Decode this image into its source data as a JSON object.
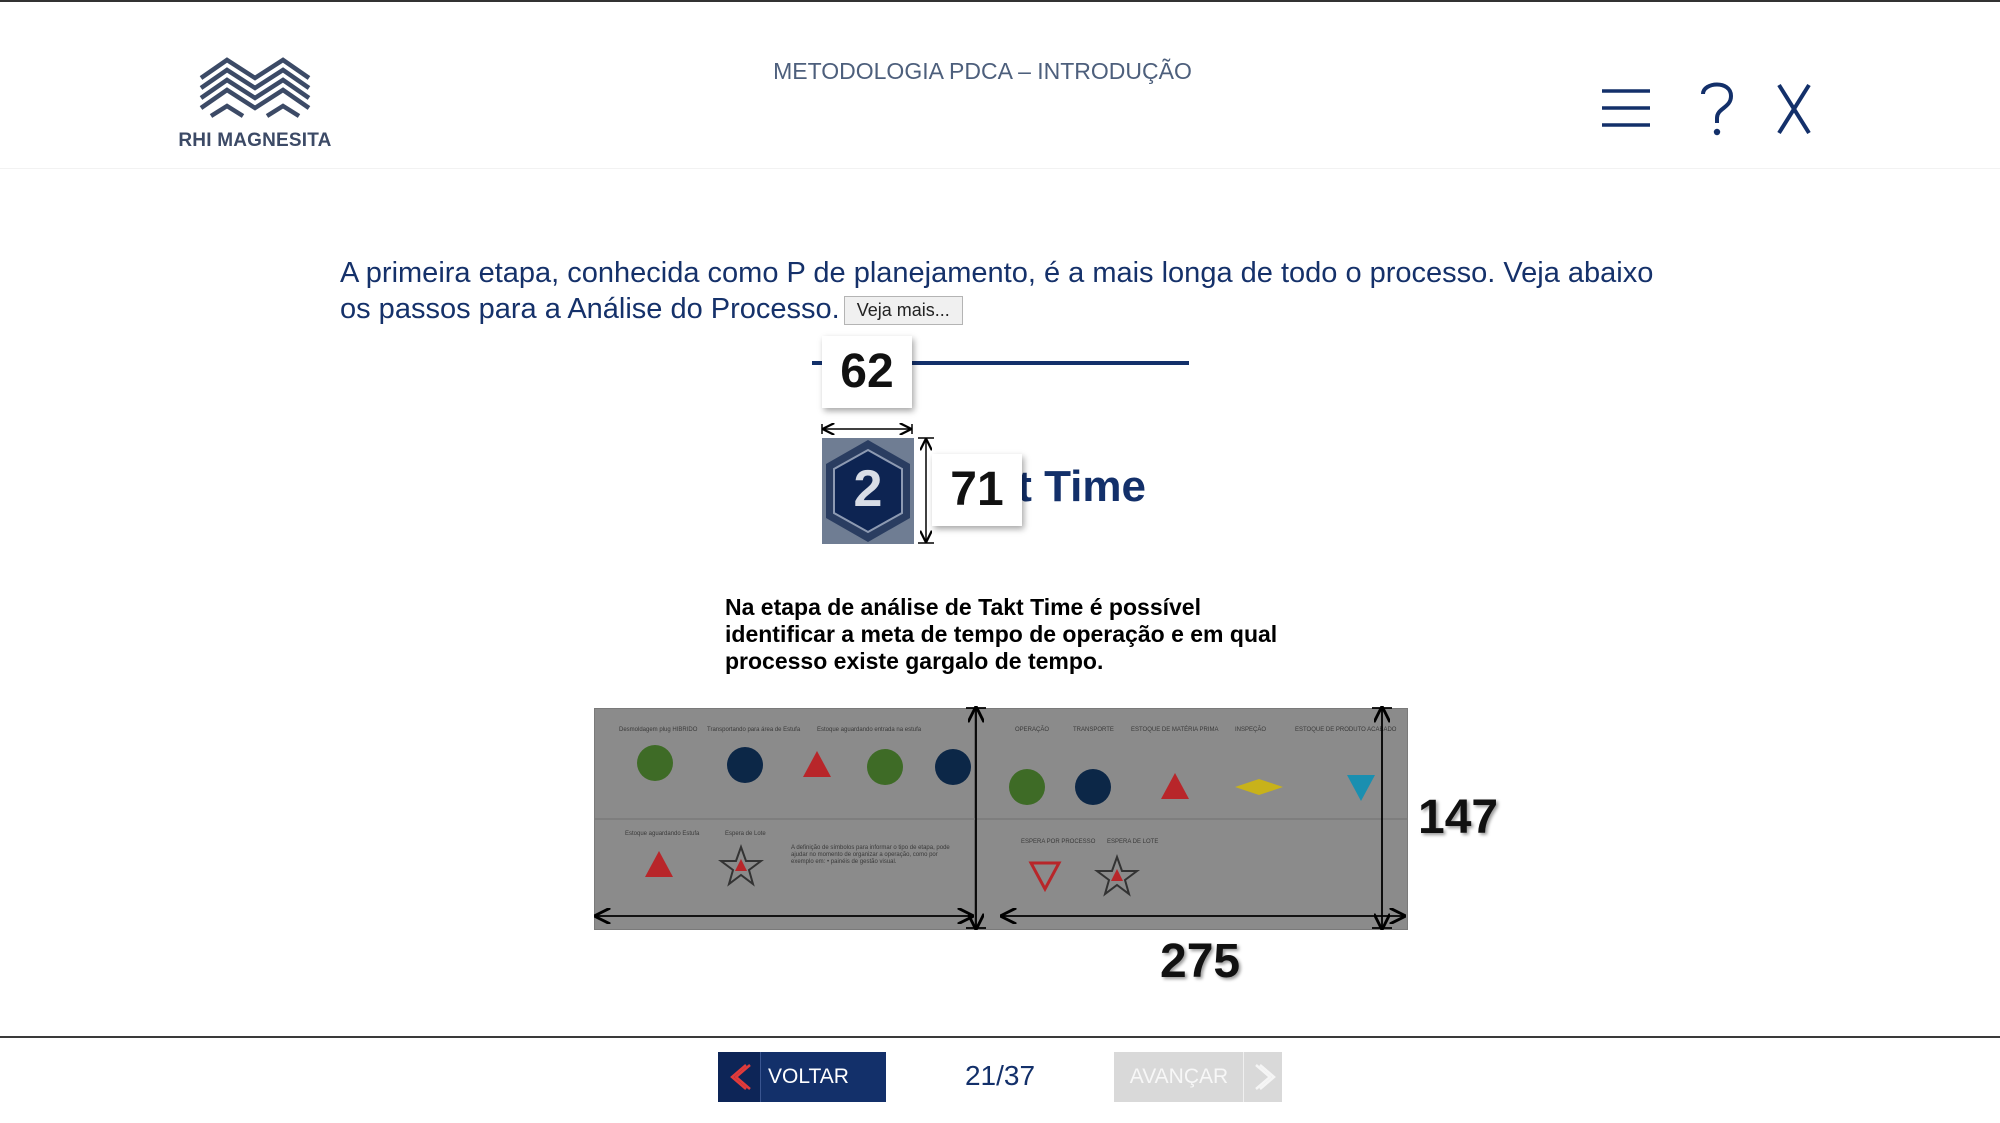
{
  "header": {
    "brand": "RHI MAGNESITA",
    "course_title": "METODOLOGIA PDCA – INTRODUÇÃO",
    "menu_icon": "menu-icon",
    "help_label": "?",
    "close_label": "X"
  },
  "content": {
    "intro_text": "A primeira etapa, conhecida como P de planejamento, é a mais longa de todo o processo. Veja abaixo os passos para a Análise do Processo.",
    "more_button": "Veja mais...",
    "step": {
      "number": "2",
      "title": "Takt Time",
      "visible_title": "ıt Time"
    },
    "description": "Na etapa de análise de Takt Time é possível identificar a meta de tempo de operação e em qual processo existe gargalo de tempo.",
    "annotations": {
      "hex_width": "62",
      "hex_height": "71",
      "figure_height": "147",
      "figure_width": "275"
    },
    "figure_labels": {
      "left_headers": [
        "Desmoldagem plug HIBRIDO",
        "Transportando para área de Estufa",
        "Estoque aguardando entrada na estufa"
      ],
      "left_lower_headers": [
        "Estoque aguardando Estufa",
        "Espera de Lote"
      ],
      "left_lower_text": "A definição de símbolos para informar o tipo de etapa, pode ajudar no momento de organizar a operação, como por exemplo em: • painéis de gestão visual.",
      "right_headers": [
        "OPERAÇÃO",
        "TRANSPORTE",
        "ESTOQUE DE MATÉRIA PRIMA",
        "INSPEÇÃO",
        "ESTOQUE DE PRODUTO ACABADO"
      ],
      "right_lower_headers": [
        "ESPERA POR PROCESSO",
        "ESPERA DE LOTE"
      ]
    }
  },
  "footer": {
    "back_label": "VOLTAR",
    "next_label": "AVANÇAR",
    "page_indicator": "21/37"
  },
  "colors": {
    "navy": "#13306a",
    "green": "#3e7a22",
    "red": "#c0282b",
    "blue": "#0c2e5c",
    "yellow": "#cdb51a",
    "cyan": "#1a8fb0",
    "disabled": "#d9d9d9"
  }
}
